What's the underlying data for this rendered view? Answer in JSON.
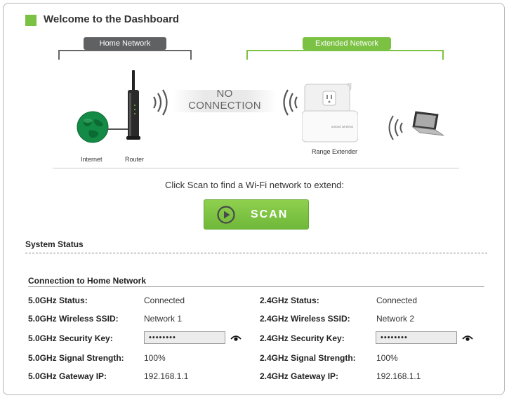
{
  "header": {
    "title": "Welcome to the Dashboard"
  },
  "diagram": {
    "home_network_label": "Home Network",
    "extended_network_label": "Extended Network",
    "no_connection_line1": "NO",
    "no_connection_line2": "CONNECTION",
    "internet_label": "Internet",
    "router_label": "Router",
    "extender_label": "Range Extender",
    "extender_brand": "amped wireless"
  },
  "scan": {
    "prompt": "Click Scan to find a Wi-Fi network to extend:",
    "button_label": "SCAN"
  },
  "system_status": {
    "title": "System Status"
  },
  "connection": {
    "title": "Connection to Home Network",
    "band_5": {
      "status_label": "5.0GHz Status:",
      "status": "Connected",
      "ssid_label": "5.0GHz Wireless SSID:",
      "ssid": "Network 1",
      "key_label": "5.0GHz Security Key:",
      "key": "••••••••",
      "signal_label": "5.0GHz Signal Strength:",
      "signal": "100%",
      "gateway_label": "5.0GHz Gateway IP:",
      "gateway": "192.168.1.1"
    },
    "band_24": {
      "status_label": "2.4GHz Status:",
      "status": "Connected",
      "ssid_label": "2.4GHz Wireless SSID:",
      "ssid": "Network 2",
      "key_label": "2.4GHz Security Key:",
      "key": "••••••••",
      "signal_label": "2.4GHz Signal Strength:",
      "signal": "100%",
      "gateway_label": "2.4GHz Gateway IP:",
      "gateway": "192.168.1.1"
    }
  },
  "icons": {
    "globe": "globe-icon",
    "router": "router-icon",
    "extender": "range-extender-icon",
    "laptop": "laptop-icon",
    "eye": "eye-icon",
    "play": "play-icon",
    "wifi": "wifi-waves-icon"
  },
  "colors": {
    "accent_green": "#7bc143",
    "gray_label": "#5f6163",
    "globe_green": "#0f7a3b"
  }
}
